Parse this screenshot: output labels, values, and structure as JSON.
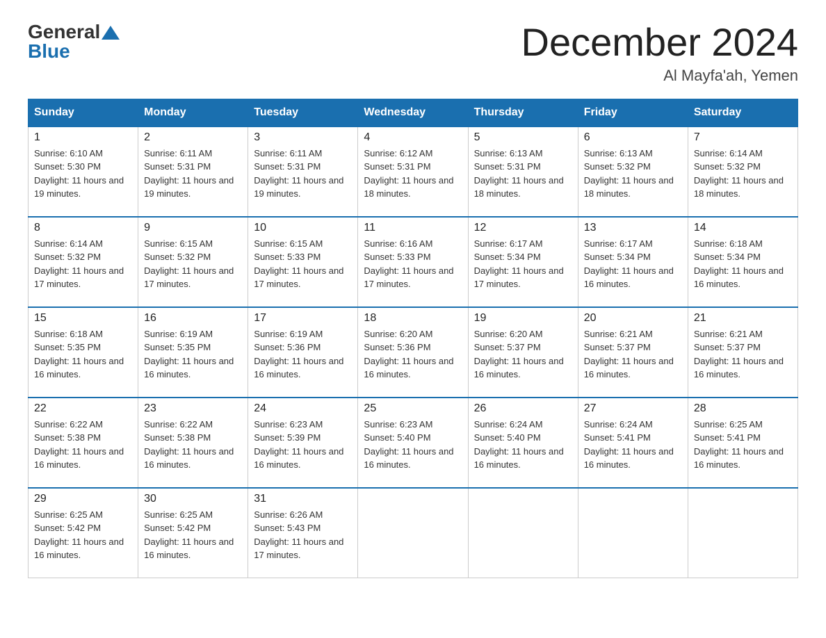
{
  "header": {
    "logo_general": "General",
    "logo_blue": "Blue",
    "title": "December 2024",
    "subtitle": "Al Mayfa'ah, Yemen"
  },
  "columns": [
    "Sunday",
    "Monday",
    "Tuesday",
    "Wednesday",
    "Thursday",
    "Friday",
    "Saturday"
  ],
  "weeks": [
    [
      {
        "day": "1",
        "sunrise": "6:10 AM",
        "sunset": "5:30 PM",
        "daylight": "11 hours and 19 minutes."
      },
      {
        "day": "2",
        "sunrise": "6:11 AM",
        "sunset": "5:31 PM",
        "daylight": "11 hours and 19 minutes."
      },
      {
        "day": "3",
        "sunrise": "6:11 AM",
        "sunset": "5:31 PM",
        "daylight": "11 hours and 19 minutes."
      },
      {
        "day": "4",
        "sunrise": "6:12 AM",
        "sunset": "5:31 PM",
        "daylight": "11 hours and 18 minutes."
      },
      {
        "day": "5",
        "sunrise": "6:13 AM",
        "sunset": "5:31 PM",
        "daylight": "11 hours and 18 minutes."
      },
      {
        "day": "6",
        "sunrise": "6:13 AM",
        "sunset": "5:32 PM",
        "daylight": "11 hours and 18 minutes."
      },
      {
        "day": "7",
        "sunrise": "6:14 AM",
        "sunset": "5:32 PM",
        "daylight": "11 hours and 18 minutes."
      }
    ],
    [
      {
        "day": "8",
        "sunrise": "6:14 AM",
        "sunset": "5:32 PM",
        "daylight": "11 hours and 17 minutes."
      },
      {
        "day": "9",
        "sunrise": "6:15 AM",
        "sunset": "5:32 PM",
        "daylight": "11 hours and 17 minutes."
      },
      {
        "day": "10",
        "sunrise": "6:15 AM",
        "sunset": "5:33 PM",
        "daylight": "11 hours and 17 minutes."
      },
      {
        "day": "11",
        "sunrise": "6:16 AM",
        "sunset": "5:33 PM",
        "daylight": "11 hours and 17 minutes."
      },
      {
        "day": "12",
        "sunrise": "6:17 AM",
        "sunset": "5:34 PM",
        "daylight": "11 hours and 17 minutes."
      },
      {
        "day": "13",
        "sunrise": "6:17 AM",
        "sunset": "5:34 PM",
        "daylight": "11 hours and 16 minutes."
      },
      {
        "day": "14",
        "sunrise": "6:18 AM",
        "sunset": "5:34 PM",
        "daylight": "11 hours and 16 minutes."
      }
    ],
    [
      {
        "day": "15",
        "sunrise": "6:18 AM",
        "sunset": "5:35 PM",
        "daylight": "11 hours and 16 minutes."
      },
      {
        "day": "16",
        "sunrise": "6:19 AM",
        "sunset": "5:35 PM",
        "daylight": "11 hours and 16 minutes."
      },
      {
        "day": "17",
        "sunrise": "6:19 AM",
        "sunset": "5:36 PM",
        "daylight": "11 hours and 16 minutes."
      },
      {
        "day": "18",
        "sunrise": "6:20 AM",
        "sunset": "5:36 PM",
        "daylight": "11 hours and 16 minutes."
      },
      {
        "day": "19",
        "sunrise": "6:20 AM",
        "sunset": "5:37 PM",
        "daylight": "11 hours and 16 minutes."
      },
      {
        "day": "20",
        "sunrise": "6:21 AM",
        "sunset": "5:37 PM",
        "daylight": "11 hours and 16 minutes."
      },
      {
        "day": "21",
        "sunrise": "6:21 AM",
        "sunset": "5:37 PM",
        "daylight": "11 hours and 16 minutes."
      }
    ],
    [
      {
        "day": "22",
        "sunrise": "6:22 AM",
        "sunset": "5:38 PM",
        "daylight": "11 hours and 16 minutes."
      },
      {
        "day": "23",
        "sunrise": "6:22 AM",
        "sunset": "5:38 PM",
        "daylight": "11 hours and 16 minutes."
      },
      {
        "day": "24",
        "sunrise": "6:23 AM",
        "sunset": "5:39 PM",
        "daylight": "11 hours and 16 minutes."
      },
      {
        "day": "25",
        "sunrise": "6:23 AM",
        "sunset": "5:40 PM",
        "daylight": "11 hours and 16 minutes."
      },
      {
        "day": "26",
        "sunrise": "6:24 AM",
        "sunset": "5:40 PM",
        "daylight": "11 hours and 16 minutes."
      },
      {
        "day": "27",
        "sunrise": "6:24 AM",
        "sunset": "5:41 PM",
        "daylight": "11 hours and 16 minutes."
      },
      {
        "day": "28",
        "sunrise": "6:25 AM",
        "sunset": "5:41 PM",
        "daylight": "11 hours and 16 minutes."
      }
    ],
    [
      {
        "day": "29",
        "sunrise": "6:25 AM",
        "sunset": "5:42 PM",
        "daylight": "11 hours and 16 minutes."
      },
      {
        "day": "30",
        "sunrise": "6:25 AM",
        "sunset": "5:42 PM",
        "daylight": "11 hours and 16 minutes."
      },
      {
        "day": "31",
        "sunrise": "6:26 AM",
        "sunset": "5:43 PM",
        "daylight": "11 hours and 17 minutes."
      },
      null,
      null,
      null,
      null
    ]
  ]
}
